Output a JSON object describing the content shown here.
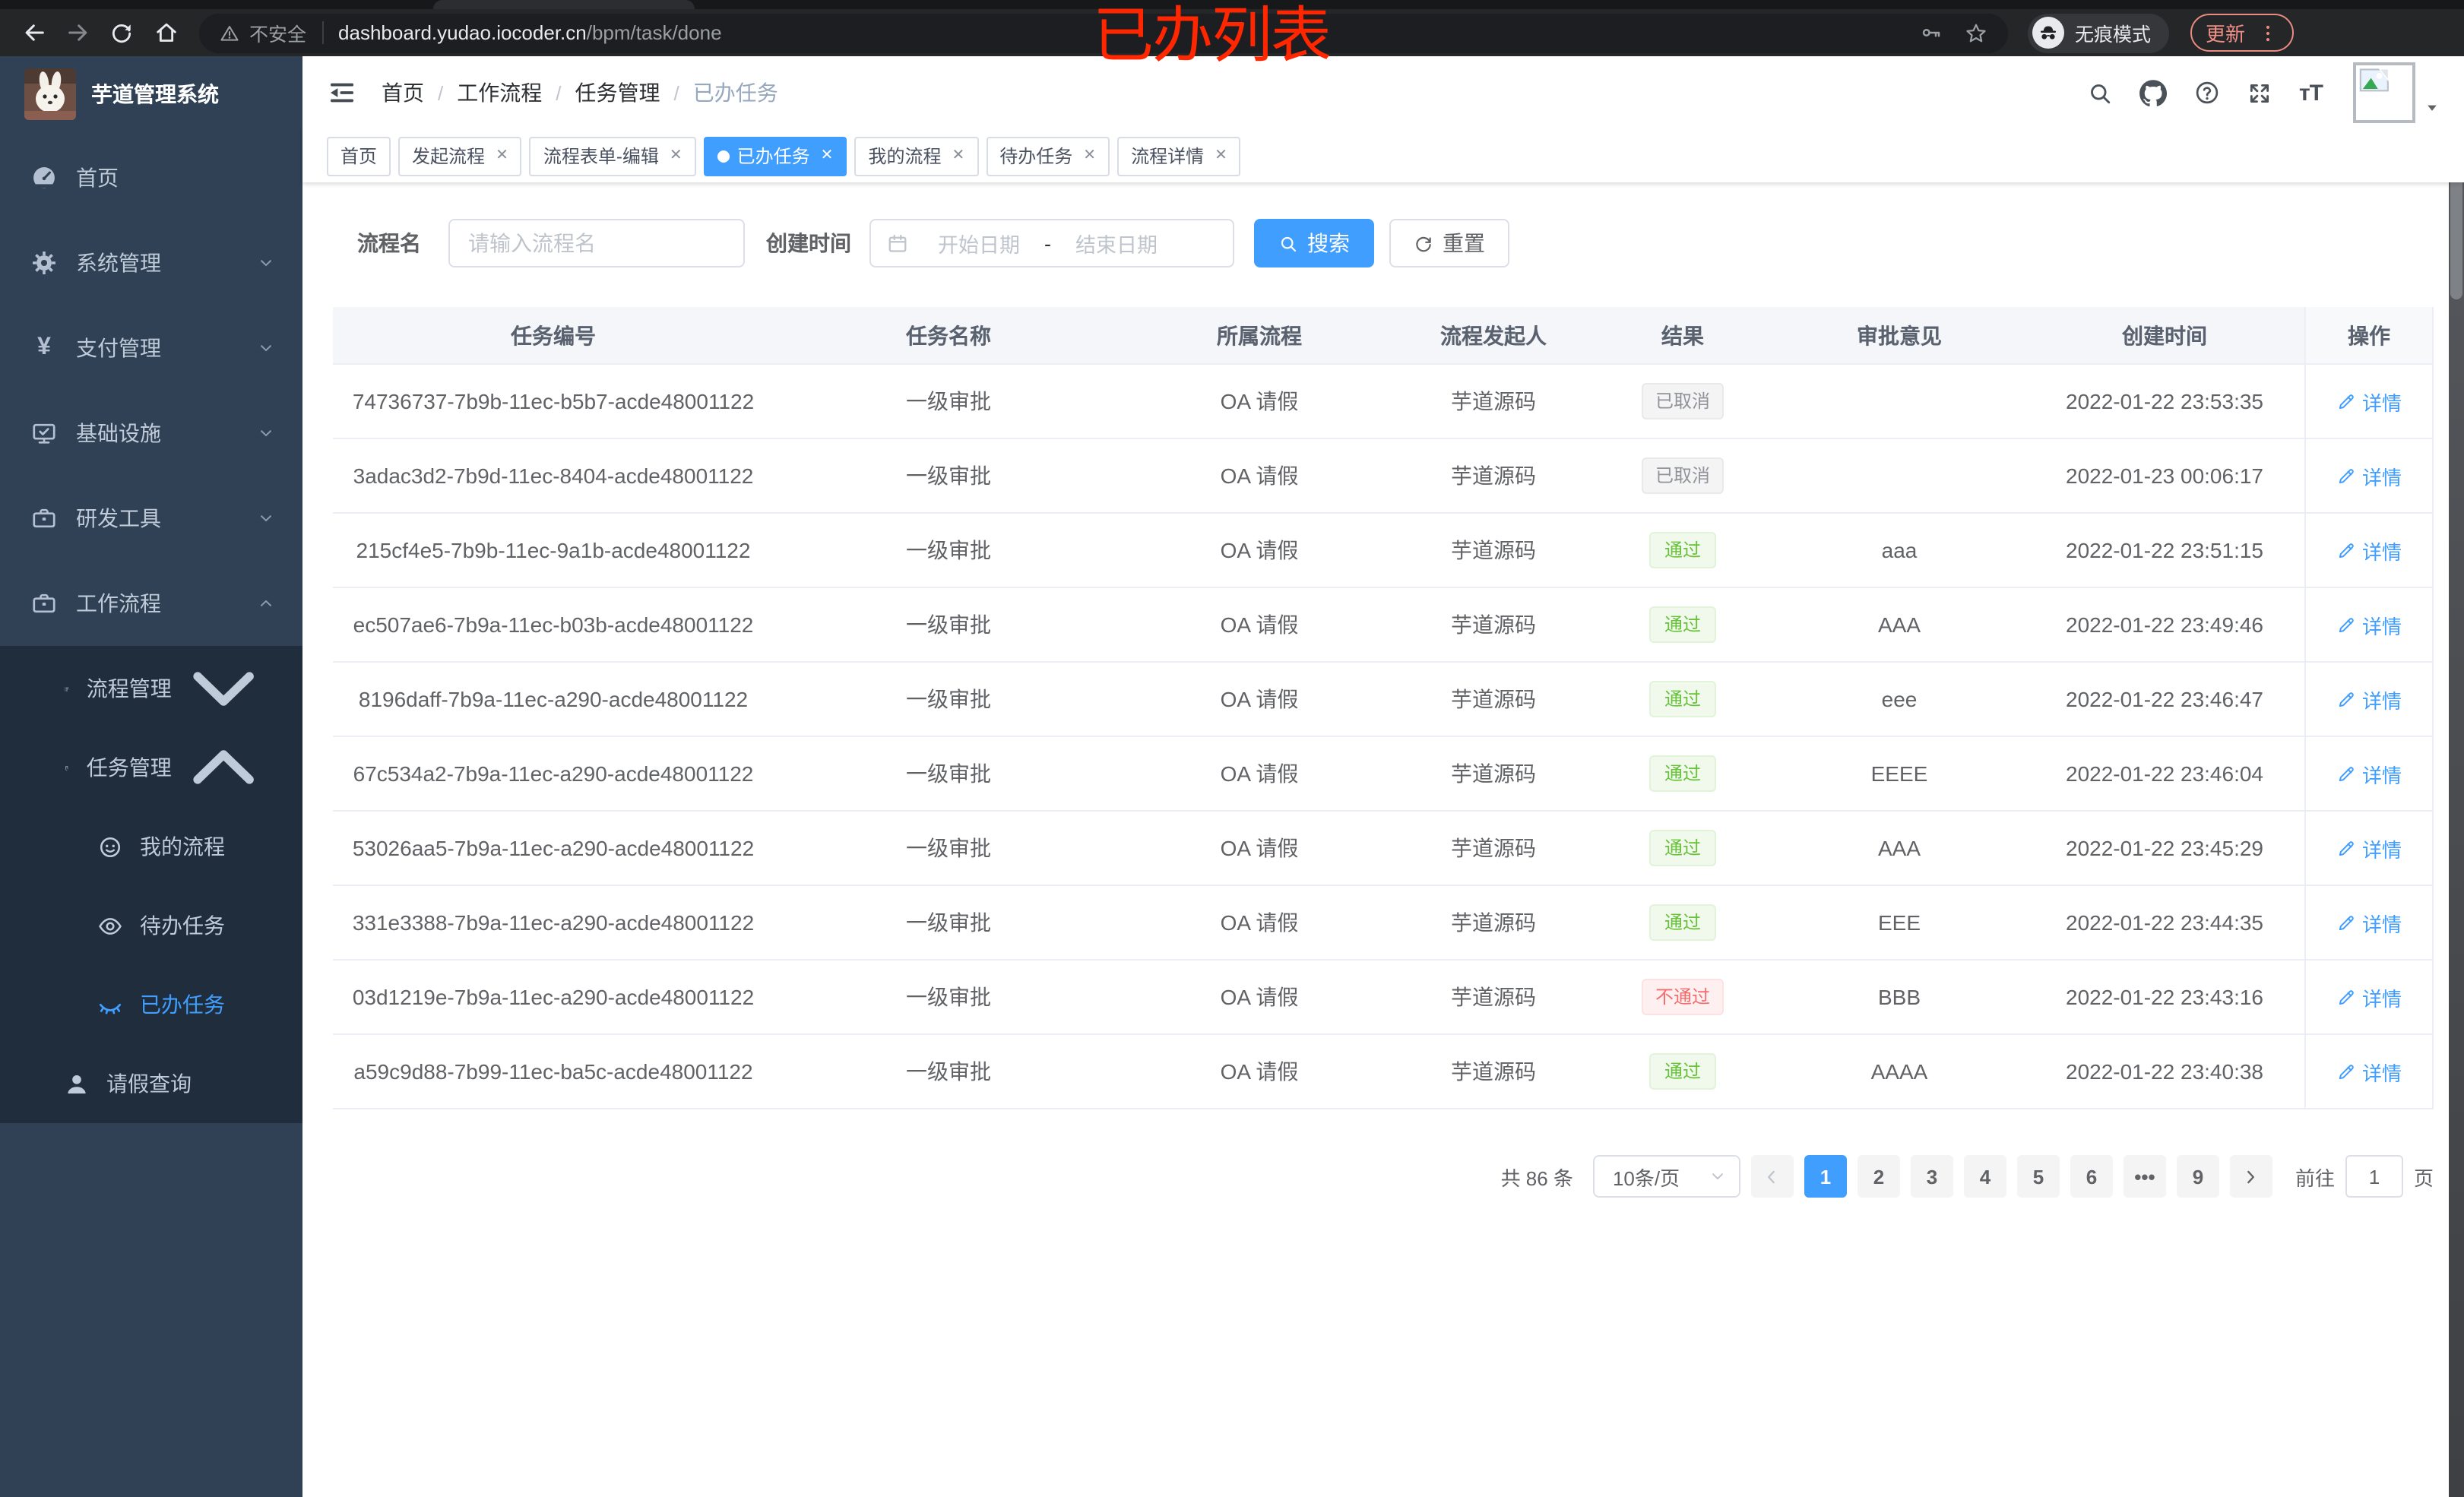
{
  "colors": {
    "accent": "#409eff",
    "success": "#67c23a",
    "danger": "#f56c6c",
    "info": "#909399",
    "sidebar_bg": "#304156",
    "submenu_bg": "#1f2d3d",
    "annotation_red": "#ff2600"
  },
  "annotation": {
    "title": "已办列表"
  },
  "browser": {
    "security_label": "不安全",
    "url_host": "dashboard.yudao.iocoder.cn",
    "url_path": "/bpm/task/done",
    "incognito_label": "无痕模式",
    "update_label": "更新"
  },
  "sidebar": {
    "app_title": "芋道管理系统",
    "items": [
      {
        "label": "首页",
        "icon": "dashboard-icon"
      },
      {
        "label": "系统管理",
        "icon": "gear-icon",
        "expandable": true
      },
      {
        "label": "支付管理",
        "icon": "yen-icon",
        "expandable": true
      },
      {
        "label": "基础设施",
        "icon": "monitor-icon",
        "expandable": true
      },
      {
        "label": "研发工具",
        "icon": "toolbox-icon",
        "expandable": true
      },
      {
        "label": "工作流程",
        "icon": "briefcase-icon",
        "expanded": true
      }
    ],
    "workflow_children": [
      {
        "label": "流程管理",
        "icon": "tree-list-icon",
        "expandable": true
      },
      {
        "label": "任务管理",
        "icon": "route-icon",
        "expanded": true
      }
    ],
    "task_children": [
      {
        "label": "我的流程",
        "icon": "face-icon"
      },
      {
        "label": "待办任务",
        "icon": "eye-icon"
      },
      {
        "label": "已办任务",
        "icon": "eye-closed-icon",
        "active": true
      }
    ],
    "leave_item": {
      "label": "请假查询",
      "icon": "user-icon"
    }
  },
  "breadcrumb": [
    "首页",
    "工作流程",
    "任务管理",
    "已办任务"
  ],
  "tabs": [
    {
      "label": "首页",
      "closable": false,
      "active": false
    },
    {
      "label": "发起流程",
      "closable": true,
      "active": false
    },
    {
      "label": "流程表单-编辑",
      "closable": true,
      "active": false
    },
    {
      "label": "已办任务",
      "closable": true,
      "active": true
    },
    {
      "label": "我的流程",
      "closable": true,
      "active": false
    },
    {
      "label": "待办任务",
      "closable": true,
      "active": false
    },
    {
      "label": "流程详情",
      "closable": true,
      "active": false
    }
  ],
  "filters": {
    "name_label": "流程名",
    "name_placeholder": "请输入流程名",
    "time_label": "创建时间",
    "start_placeholder": "开始日期",
    "range_separator": "-",
    "end_placeholder": "结束日期",
    "search_label": "搜索",
    "reset_label": "重置"
  },
  "table": {
    "headers": [
      "任务编号",
      "任务名称",
      "所属流程",
      "流程发起人",
      "结果",
      "审批意见",
      "创建时间",
      "操作"
    ],
    "action_label": "详情",
    "rows": [
      {
        "id": "74736737-7b9b-11ec-b5b7-acde48001122",
        "name": "一级审批",
        "process": "OA 请假",
        "starter": "芋道源码",
        "result": "已取消",
        "result_type": "info",
        "comment": "",
        "created": "2022-01-22 23:53:35"
      },
      {
        "id": "3adac3d2-7b9d-11ec-8404-acde48001122",
        "name": "一级审批",
        "process": "OA 请假",
        "starter": "芋道源码",
        "result": "已取消",
        "result_type": "info",
        "comment": "",
        "created": "2022-01-23 00:06:17"
      },
      {
        "id": "215cf4e5-7b9b-11ec-9a1b-acde48001122",
        "name": "一级审批",
        "process": "OA 请假",
        "starter": "芋道源码",
        "result": "通过",
        "result_type": "success",
        "comment": "aaa",
        "created": "2022-01-22 23:51:15"
      },
      {
        "id": "ec507ae6-7b9a-11ec-b03b-acde48001122",
        "name": "一级审批",
        "process": "OA 请假",
        "starter": "芋道源码",
        "result": "通过",
        "result_type": "success",
        "comment": "AAA",
        "created": "2022-01-22 23:49:46"
      },
      {
        "id": "8196daff-7b9a-11ec-a290-acde48001122",
        "name": "一级审批",
        "process": "OA 请假",
        "starter": "芋道源码",
        "result": "通过",
        "result_type": "success",
        "comment": "eee",
        "created": "2022-01-22 23:46:47"
      },
      {
        "id": "67c534a2-7b9a-11ec-a290-acde48001122",
        "name": "一级审批",
        "process": "OA 请假",
        "starter": "芋道源码",
        "result": "通过",
        "result_type": "success",
        "comment": "EEEE",
        "created": "2022-01-22 23:46:04"
      },
      {
        "id": "53026aa5-7b9a-11ec-a290-acde48001122",
        "name": "一级审批",
        "process": "OA 请假",
        "starter": "芋道源码",
        "result": "通过",
        "result_type": "success",
        "comment": "AAA",
        "created": "2022-01-22 23:45:29"
      },
      {
        "id": "331e3388-7b9a-11ec-a290-acde48001122",
        "name": "一级审批",
        "process": "OA 请假",
        "starter": "芋道源码",
        "result": "通过",
        "result_type": "success",
        "comment": "EEE",
        "created": "2022-01-22 23:44:35"
      },
      {
        "id": "03d1219e-7b9a-11ec-a290-acde48001122",
        "name": "一级审批",
        "process": "OA 请假",
        "starter": "芋道源码",
        "result": "不通过",
        "result_type": "danger",
        "comment": "BBB",
        "created": "2022-01-22 23:43:16"
      },
      {
        "id": "a59c9d88-7b99-11ec-ba5c-acde48001122",
        "name": "一级审批",
        "process": "OA 请假",
        "starter": "芋道源码",
        "result": "通过",
        "result_type": "success",
        "comment": "AAAA",
        "created": "2022-01-22 23:40:38"
      }
    ]
  },
  "pagination": {
    "total": "共 86 条",
    "page_size": "10条/页",
    "pages": [
      {
        "label": "1",
        "active": true
      },
      {
        "label": "2"
      },
      {
        "label": "3"
      },
      {
        "label": "4"
      },
      {
        "label": "5"
      },
      {
        "label": "6"
      },
      {
        "label": "•••",
        "ellipsis": true
      },
      {
        "label": "9"
      }
    ],
    "jumper_prefix": "前往",
    "jumper_value": "1",
    "jumper_suffix": "页"
  }
}
